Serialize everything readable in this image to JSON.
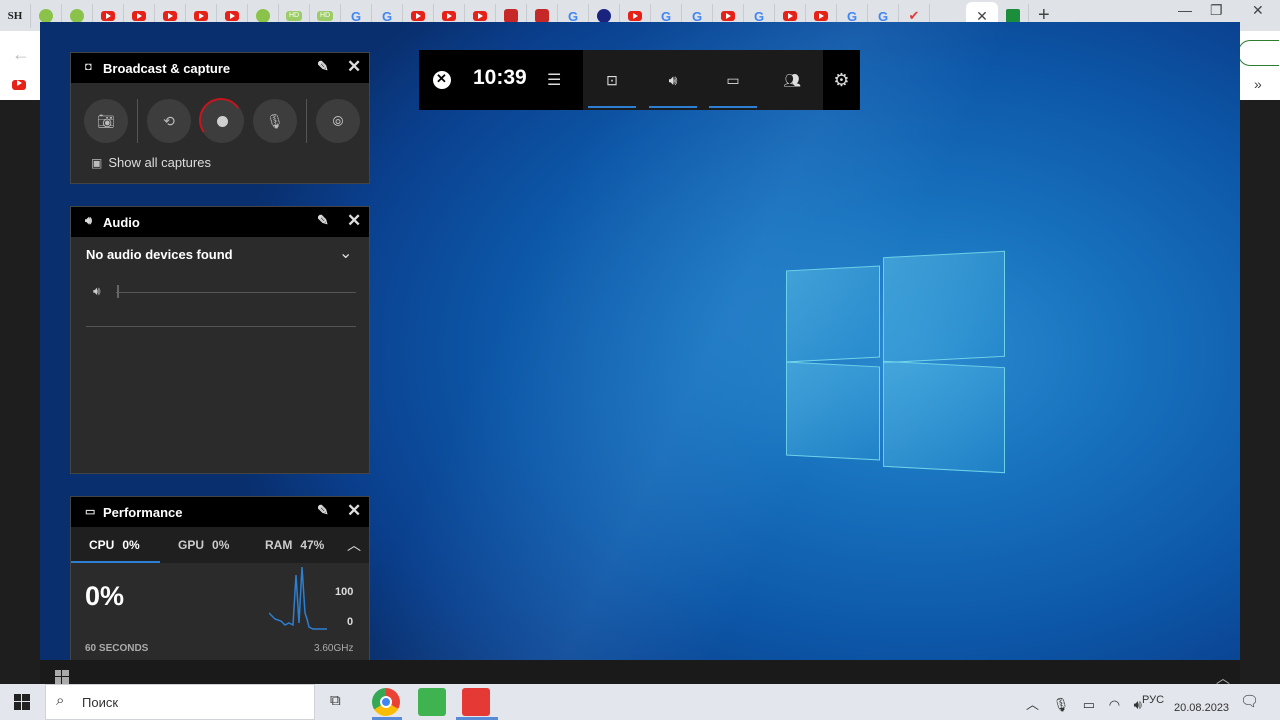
{
  "browser": {
    "tabs": [
      "sh",
      "leaf",
      "leaf",
      "yt",
      "yt",
      "yt",
      "yt",
      "yt",
      "flower",
      "hd",
      "hd",
      "g",
      "g",
      "yt",
      "yt",
      "yt",
      "rose",
      "rose",
      "g",
      "blue",
      "yt",
      "g",
      "g",
      "yt",
      "g",
      "yt",
      "yt",
      "g",
      "g",
      "check"
    ],
    "active_tab_close": "✕",
    "new_tab": "+",
    "sh_label": "SH",
    "hd_label": "HD",
    "g_label": "G"
  },
  "gamebar": {
    "time": "10:39",
    "buttons": [
      "capture-icon",
      "audio-icon",
      "performance-icon",
      "social-icon"
    ]
  },
  "broadcast": {
    "title": "Broadcast & capture",
    "show_all": "Show all captures"
  },
  "audio": {
    "title": "Audio",
    "device": "No audio devices found"
  },
  "performance": {
    "title": "Performance",
    "cpu_label": "CPU",
    "cpu_value": "0%",
    "gpu_label": "GPU",
    "gpu_value": "0%",
    "ram_label": "RAM",
    "ram_value": "47%",
    "big_value": "0%",
    "max_label": "100",
    "min_label": "0",
    "seconds_label": "60 SECONDS",
    "clock_label": "3.60GHz"
  },
  "host_taskbar": {
    "search_placeholder": "Поиск",
    "lang": "РУС",
    "date": "20.08.2023"
  }
}
